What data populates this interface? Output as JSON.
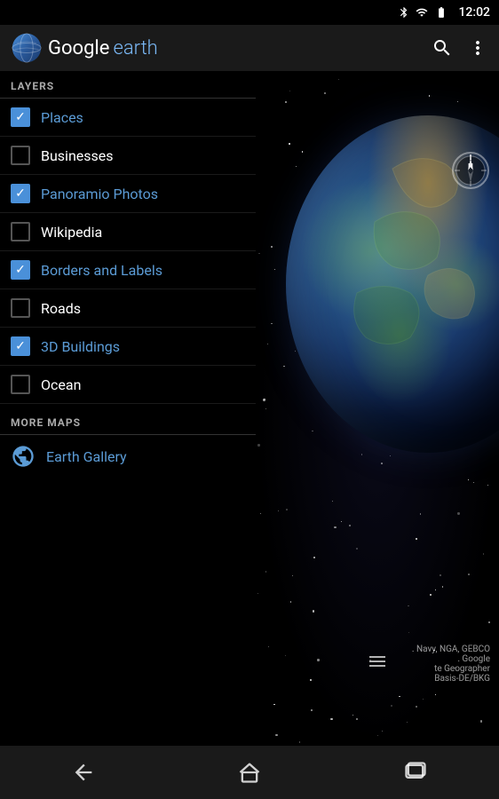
{
  "status_bar": {
    "time": "12:02",
    "bluetooth_icon": "bluetooth",
    "wifi_icon": "wifi",
    "battery_icon": "battery"
  },
  "header": {
    "logo_google": "Google",
    "logo_earth": "earth",
    "search_icon": "search",
    "more_icon": "more-vertical"
  },
  "layers_section": {
    "title": "LAYERS",
    "items": [
      {
        "id": "places",
        "label": "Places",
        "checked": true,
        "active": true
      },
      {
        "id": "businesses",
        "label": "Businesses",
        "checked": false,
        "active": false
      },
      {
        "id": "panoramio",
        "label": "Panoramio Photos",
        "checked": true,
        "active": true
      },
      {
        "id": "wikipedia",
        "label": "Wikipedia",
        "checked": false,
        "active": false
      },
      {
        "id": "borders",
        "label": "Borders and Labels",
        "checked": true,
        "active": true
      },
      {
        "id": "roads",
        "label": "Roads",
        "checked": false,
        "active": false
      },
      {
        "id": "buildings",
        "label": "3D Buildings",
        "checked": true,
        "active": true
      },
      {
        "id": "ocean",
        "label": "Ocean",
        "checked": false,
        "active": false
      }
    ]
  },
  "more_maps_section": {
    "title": "MORE MAPS",
    "items": [
      {
        "id": "earth-gallery",
        "label": "Earth Gallery",
        "icon": "globe"
      }
    ]
  },
  "copyright": {
    "lines": [
      ". Navy, NGA, GEBCO",
      ". Google",
      "te Geographer",
      "Basis-DE/BKG"
    ]
  },
  "nav_bar": {
    "back_icon": "back-arrow",
    "home_icon": "home",
    "recents_icon": "recents"
  }
}
